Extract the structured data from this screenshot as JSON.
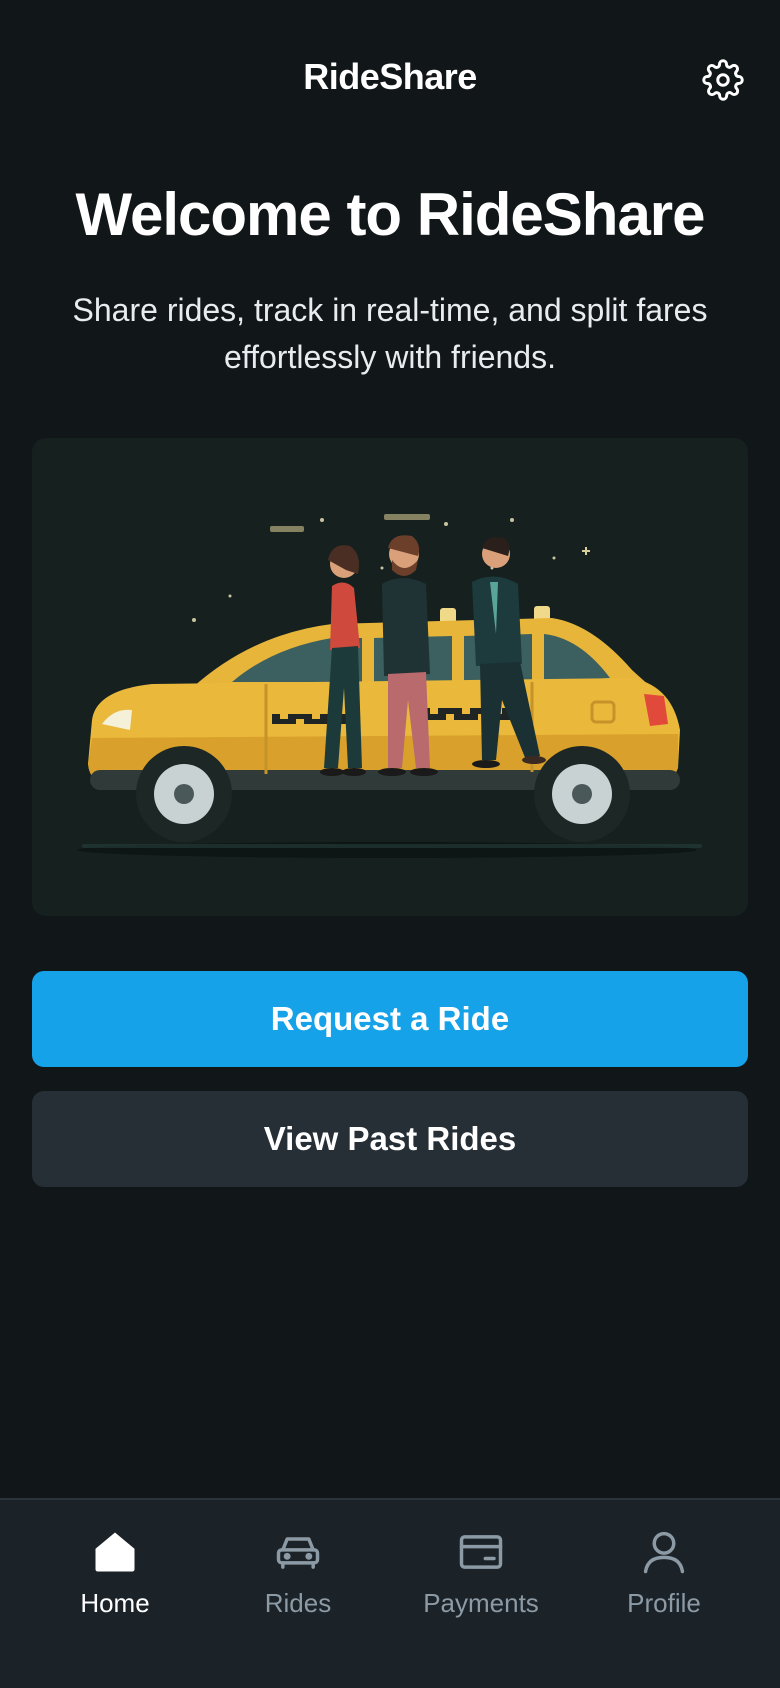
{
  "header": {
    "title": "RideShare",
    "settings_icon": "gear-icon"
  },
  "welcome": {
    "title": "Welcome to RideShare",
    "subtitle": "Share rides, track in real-time, and split fares effortlessly with friends."
  },
  "hero": {
    "image": "illustration of three people walking beside a yellow taxi at night"
  },
  "actions": {
    "primary_label": "Request a Ride",
    "secondary_label": "View Past Rides"
  },
  "nav": {
    "items": [
      {
        "label": "Home",
        "icon": "home-icon",
        "active": true
      },
      {
        "label": "Rides",
        "icon": "car-icon",
        "active": false
      },
      {
        "label": "Payments",
        "icon": "credit-card-icon",
        "active": false
      },
      {
        "label": "Profile",
        "icon": "user-icon",
        "active": false
      }
    ]
  },
  "colors": {
    "background": "#111619",
    "primary": "#16a2e9",
    "secondary": "#262f36",
    "nav_background": "#1c2328",
    "taxi_yellow": "#e9b83a"
  }
}
